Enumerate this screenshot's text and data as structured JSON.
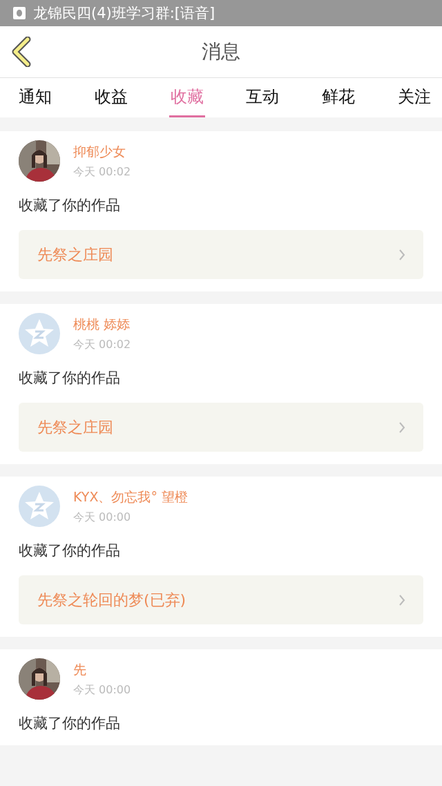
{
  "status_bar": {
    "notification": "龙锦民四(4)班学习群:[语音]"
  },
  "header": {
    "title": "消息"
  },
  "tabs": [
    {
      "label": "通知",
      "selected": false
    },
    {
      "label": "收益",
      "selected": false
    },
    {
      "label": "收藏",
      "selected": true
    },
    {
      "label": "互动",
      "selected": false
    },
    {
      "label": "鲜花",
      "selected": false
    },
    {
      "label": "关注",
      "selected": false
    }
  ],
  "messages": [
    {
      "name": "抑郁少女",
      "time": "今天 00:02",
      "action": "收藏了你的作品",
      "work": "先祭之庄园"
    },
    {
      "avatar": {
        "kind": "default"
      },
      "name": "桃桃 婖婖",
      "time": "今天 00:02",
      "action": "收藏了你的作品",
      "work": "先祭之庄园"
    },
    {
      "avatar": {
        "kind": "default"
      },
      "name": "KYX、勿忘我° 望橙",
      "time": "今天 00:00",
      "action": "收藏了你的作品",
      "work": "先祭之轮回的梦(已弃)"
    },
    {
      "name": "先",
      "time": "今天 00:00",
      "action": "收藏了你的作品"
    }
  ]
}
